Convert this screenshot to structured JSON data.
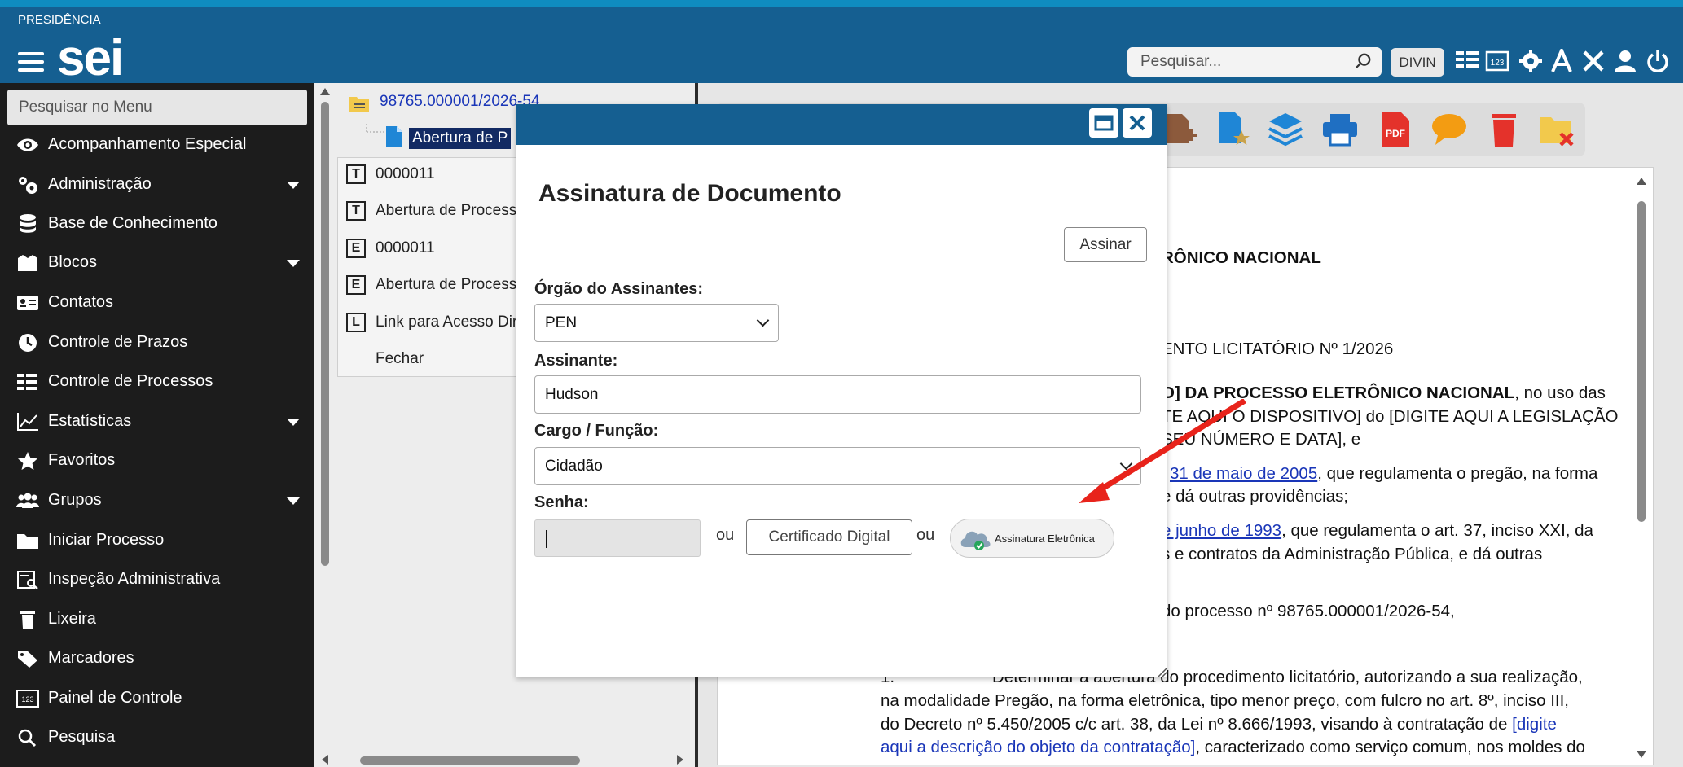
{
  "header": {
    "organization": "PRESIDÊNCIA",
    "logo_text": "sei",
    "search_placeholder": "Pesquisar...",
    "unit": "DIVIN",
    "brand_color": "#155f91"
  },
  "sidebar": {
    "search_placeholder": "Pesquisar no Menu",
    "items": [
      {
        "label": "Acompanhamento Especial",
        "icon": "eye-icon",
        "has_submenu": false
      },
      {
        "label": "Administração",
        "icon": "gears-icon",
        "has_submenu": true
      },
      {
        "label": "Base de Conhecimento",
        "icon": "database-icon",
        "has_submenu": false
      },
      {
        "label": "Blocos",
        "icon": "blocks-icon",
        "has_submenu": true
      },
      {
        "label": "Contatos",
        "icon": "contact-card-icon",
        "has_submenu": false
      },
      {
        "label": "Controle de Prazos",
        "icon": "clock-icon",
        "has_submenu": false
      },
      {
        "label": "Controle de Processos",
        "icon": "list-icon",
        "has_submenu": false
      },
      {
        "label": "Estatísticas",
        "icon": "chart-icon",
        "has_submenu": true
      },
      {
        "label": "Favoritos",
        "icon": "star-icon",
        "has_submenu": false
      },
      {
        "label": "Grupos",
        "icon": "group-icon",
        "has_submenu": true
      },
      {
        "label": "Iniciar Processo",
        "icon": "folder-icon",
        "has_submenu": false
      },
      {
        "label": "Inspeção Administrativa",
        "icon": "inspection-icon",
        "has_submenu": false
      },
      {
        "label": "Lixeira",
        "icon": "trash-icon",
        "has_submenu": false
      },
      {
        "label": "Marcadores",
        "icon": "tag-icon",
        "has_submenu": false
      },
      {
        "label": "Painel de Controle",
        "icon": "panel-123-icon",
        "has_submenu": false
      },
      {
        "label": "Pesquisa",
        "icon": "search-icon",
        "has_submenu": false
      }
    ]
  },
  "tree": {
    "process_number": "98765.000001/2026-54",
    "selected_doc": "Abertura de P"
  },
  "context_menu": {
    "items": [
      {
        "badge": "T",
        "label": "0000011"
      },
      {
        "badge": "T",
        "label": "Abertura de Processo"
      },
      {
        "badge": "E",
        "label": "0000011"
      },
      {
        "badge": "E",
        "label": "Abertura de Processo"
      },
      {
        "badge": "L",
        "label": "Link para Acesso Direto"
      },
      {
        "badge": "",
        "label": "Fechar"
      }
    ]
  },
  "document": {
    "heading": "RÔNICO NACIONAL",
    "subheading": "ENTO LICITATÓRIO Nº 1/2026",
    "p1a_bold": "O] DA PROCESSO ELETRÔNICO NACIONAL",
    "p1a_rest": ", no uso das",
    "p1b": "TE AQUI O DISPOSITIVO] do [DIGITE AQUI A LEGISLAÇÃO",
    "p1c": "SEU NÚMERO E DATA], e",
    "p2a_link": "31 de maio de 2005",
    "p2a_rest": ", que regulamenta o pregão, na forma",
    "p2b": "e dá outras providências;",
    "p3a_link": "e junho de 1993",
    "p3a_rest": ", que regulamenta o art. 37, inciso XXI, da",
    "p3b": "s e contratos da Administração Pública,  e dá outras",
    "p4": "do processo nº 98765.000001/2026-54,",
    "item_num": "1.",
    "item_l1": "Determinar a abertura do procedimento licitatório, autorizando a sua realização,",
    "item_l2": "na modalidade Pregão, na forma eletrônica, tipo menor preço, com fulcro no art. 8º, inciso III,",
    "item_l3a": "do Decreto nº 5.450/2005 c/c art. 38, da Lei nº 8.666/1993, visando à contratação de ",
    "item_l3b": "[digite",
    "item_l4a": "aqui a descrição do objeto da contratação]",
    "item_l4b": ", caracterizado como serviço comum, nos moldes do"
  },
  "modal": {
    "title": "Assinatura de Documento",
    "sign_button": "Assinar",
    "org_label": "Órgão do Assinantes:",
    "org_value": "PEN",
    "signer_label": "Assinante:",
    "signer_value": "Hudson",
    "role_label": "Cargo / Função:",
    "role_value": "Cidadão",
    "password_label": "Senha:",
    "or_text": "ou",
    "cert_button": "Certificado Digital",
    "esig_button": "Assinatura Eletrônica"
  },
  "annotation": {
    "arrow_color": "#e8231b"
  }
}
